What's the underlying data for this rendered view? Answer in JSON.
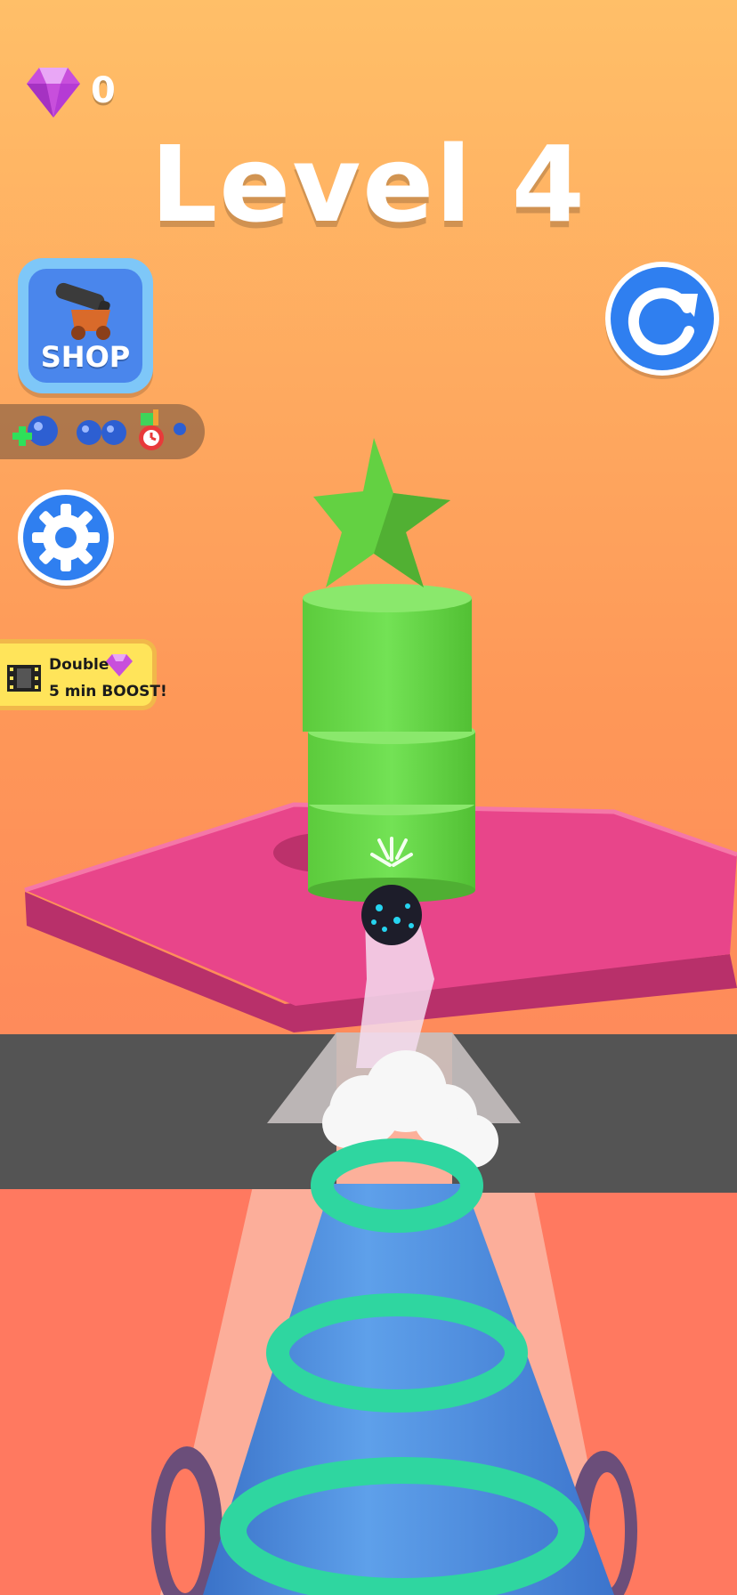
{
  "hud": {
    "gem_count": "0",
    "level_title": "Level 4",
    "shop_label": "SHOP",
    "double_boost": {
      "line1": "Double",
      "line2": "5 min BOOST!"
    },
    "boost_icons": [
      "add-ball-icon",
      "double-ball-icon",
      "slow-timer-icon"
    ]
  },
  "icons": {
    "gem": "gem-icon",
    "shop": "cannon-icon",
    "restart": "restart-icon",
    "settings": "gear-icon",
    "video": "video-icon"
  },
  "colors": {
    "sky_top": "#ffbe66",
    "sky_bottom": "#ff7a5a",
    "platform": "#e8458a",
    "tower": "#6ad84a",
    "cannon": "#4f92dd",
    "cannon_rings": "#2fd6a0",
    "accent_blue": "#2f7ff0",
    "boost_yellow": "#ffe45a"
  }
}
